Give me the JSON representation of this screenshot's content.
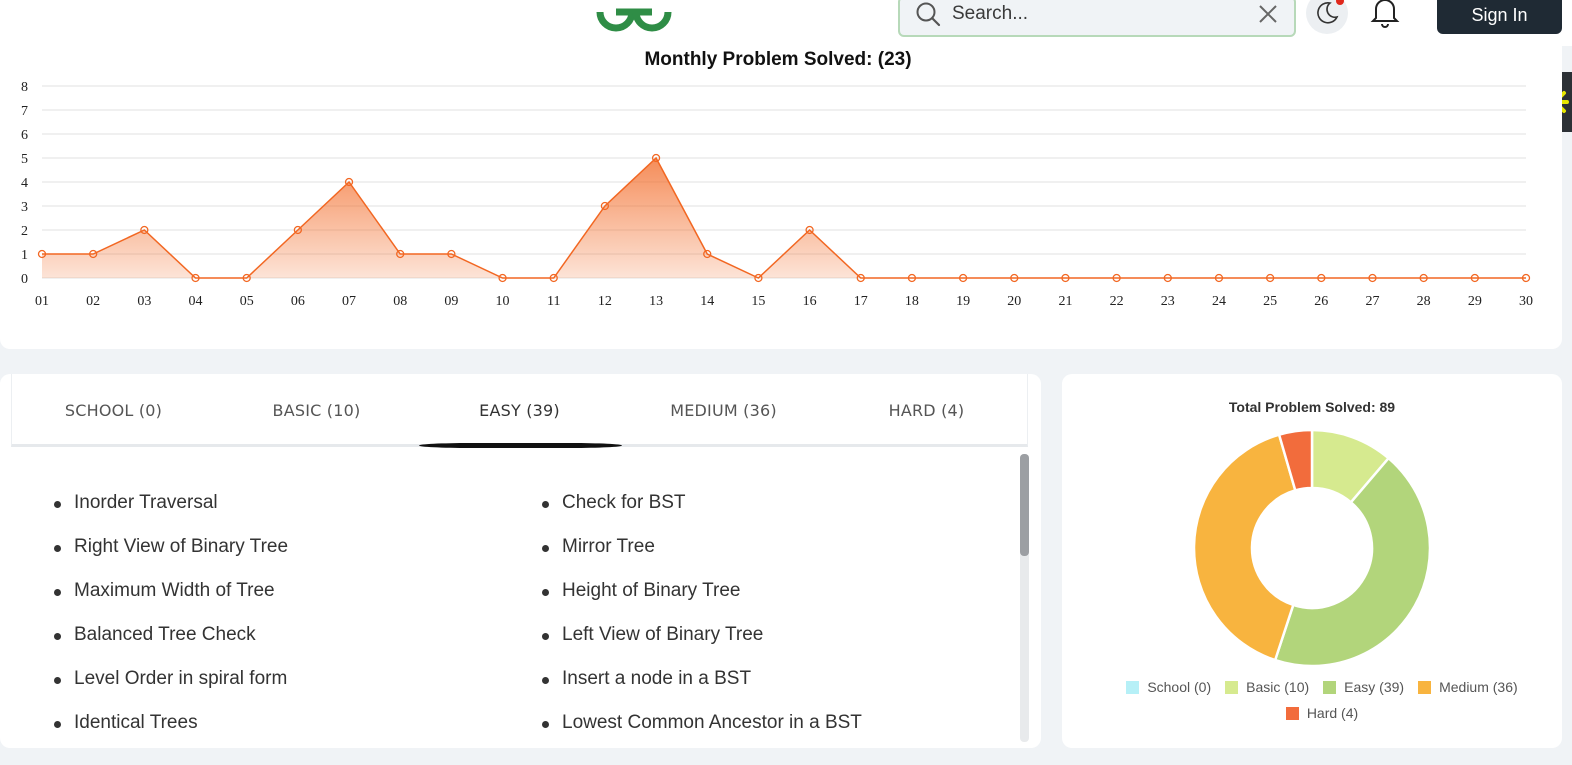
{
  "header": {
    "search_placeholder": "Search...",
    "signin_label": "Sign In",
    "colors": {
      "brand_green": "#2f8d46",
      "button_dark": "#1f2a34"
    }
  },
  "monthly_chart": {
    "title": "Monthly Problem Solved: (23)"
  },
  "tabs": [
    {
      "label": "SCHOOL (0)",
      "active": false
    },
    {
      "label": "BASIC (10)",
      "active": false
    },
    {
      "label": "EASY (39)",
      "active": true
    },
    {
      "label": "MEDIUM (36)",
      "active": false
    },
    {
      "label": "HARD (4)",
      "active": false
    }
  ],
  "problems": {
    "left": [
      "Inorder Traversal",
      "Right View of Binary Tree",
      "Maximum Width of Tree",
      "Balanced Tree Check",
      "Level Order in spiral form",
      "Identical Trees"
    ],
    "right": [
      "Check for BST",
      "Mirror Tree",
      "Height of Binary Tree",
      "Left View of Binary Tree",
      "Insert a node in a BST",
      "Lowest Common Ancestor in a BST"
    ]
  },
  "donut": {
    "title": "Total Problem Solved: 89",
    "legend": [
      "School (0)",
      "Basic (10)",
      "Easy (39)",
      "Medium (36)",
      "Hard (4)"
    ]
  },
  "chart_data": [
    {
      "type": "area",
      "title": "Monthly Problem Solved: (23)",
      "x": [
        "01",
        "02",
        "03",
        "04",
        "05",
        "06",
        "07",
        "08",
        "09",
        "10",
        "11",
        "12",
        "13",
        "14",
        "15",
        "16",
        "17",
        "18",
        "19",
        "20",
        "21",
        "22",
        "23",
        "24",
        "25",
        "26",
        "27",
        "28",
        "29",
        "30"
      ],
      "values": [
        1,
        1,
        2,
        0,
        0,
        2,
        4,
        1,
        1,
        0,
        0,
        3,
        5,
        1,
        0,
        2,
        0,
        0,
        0,
        0,
        0,
        0,
        0,
        0,
        0,
        0,
        0,
        0,
        0,
        0
      ],
      "ylim": [
        0,
        8
      ],
      "yticks": [
        0,
        1,
        2,
        3,
        4,
        5,
        6,
        7,
        8
      ],
      "grid": true,
      "color": "#f26722"
    },
    {
      "type": "pie",
      "title": "Total Problem Solved: 89",
      "categories": [
        "School (0)",
        "Basic (10)",
        "Easy (39)",
        "Medium (36)",
        "Hard (4)"
      ],
      "values": [
        0,
        10,
        39,
        36,
        4
      ],
      "colors": [
        "#b6f0f7",
        "#d6ea8f",
        "#b2d57b",
        "#f8b43f",
        "#f26c3c"
      ],
      "legend": "bottom",
      "donut": true
    }
  ]
}
